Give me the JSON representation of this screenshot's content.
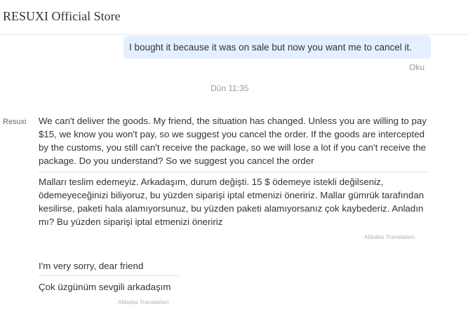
{
  "header": {
    "store_name": "RESUXI Official Store"
  },
  "conversation": {
    "outgoing": {
      "text": "I bought it because it was on sale but now you want me to cancel it.",
      "status": "Oku"
    },
    "timestamp": "Dün 11:35",
    "sender_name": "Resuxi",
    "messages": [
      {
        "original": "We can't deliver the goods. My friend, the situation has changed. Unless you are willing to pay $15, we know you won't pay, so we suggest you cancel the order. If the goods are intercepted by the customs, you still can't receive the package, so we will lose a lot if you can't receive the package. Do you understand? So we suggest you cancel the order",
        "translation": "Malları teslim edemeyiz. Arkadaşım, durum değişti. 15 $ ödemeye istekli değilseniz, ödemeyeceğinizi biliyoruz, bu yüzden siparişi iptal etmenizi öneririz. Mallar gümrük tarafından kesilirse, paketi hala alamıyorsunuz, bu yüzden paketi alamıyorsanız çok kaybederiz. Anladın mı? Bu yüzden siparişi iptal etmenizi öneririz",
        "translation_credit": "Alibaba Translation"
      },
      {
        "original": "I'm very sorry, dear friend",
        "translation": "Çok üzgünüm sevgili arkadaşım",
        "translation_credit": "Alibaba Translation"
      }
    ]
  },
  "colors": {
    "outgoing_bubble": "#e6efff",
    "muted_text": "#999999",
    "divider": "#e3e3e3"
  }
}
